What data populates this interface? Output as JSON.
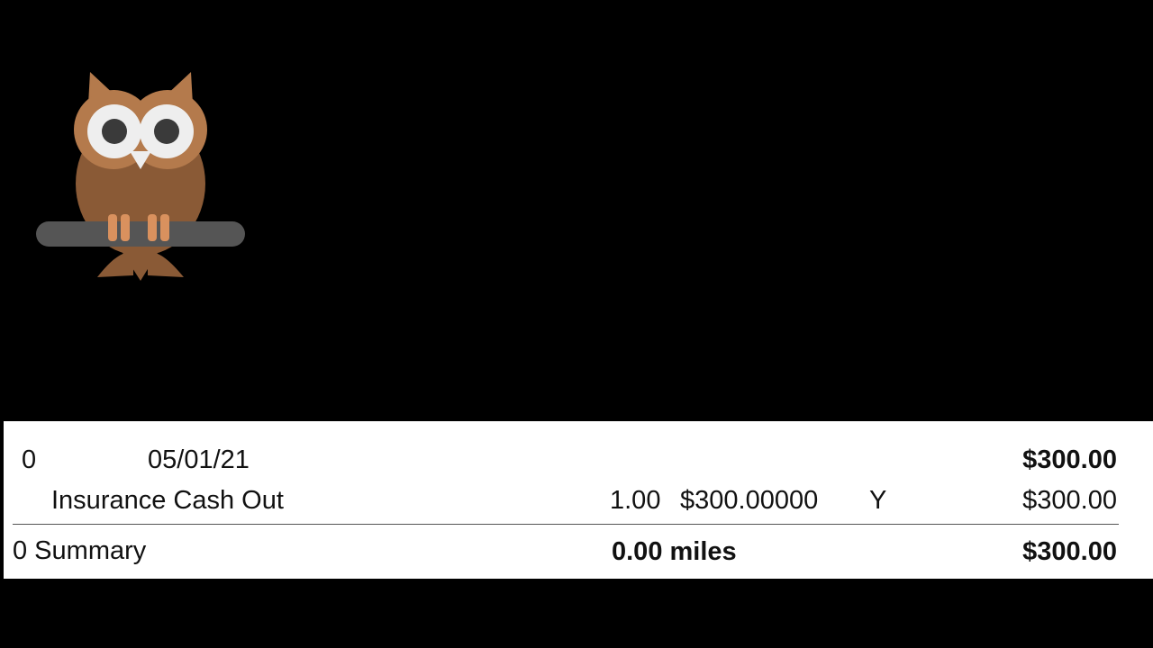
{
  "colors": {
    "background": "#000000",
    "report_background": "#ffffff",
    "text": "#111111",
    "owl_body": "#8a5a36",
    "owl_face": "#b47a4c",
    "owl_feet": "#d9915e",
    "branch": "#555555"
  },
  "logo": {
    "icon": "owl-icon"
  },
  "report": {
    "header_row": {
      "id": "0",
      "date": "05/01/21",
      "total": "$300.00"
    },
    "line_item": {
      "description": "Insurance Cash Out",
      "quantity": "1.00",
      "rate": "$300.00000",
      "flag": "Y",
      "amount": "$300.00"
    },
    "summary": {
      "label": "0 Summary",
      "miles": "0.00 miles",
      "total": "$300.00"
    }
  }
}
